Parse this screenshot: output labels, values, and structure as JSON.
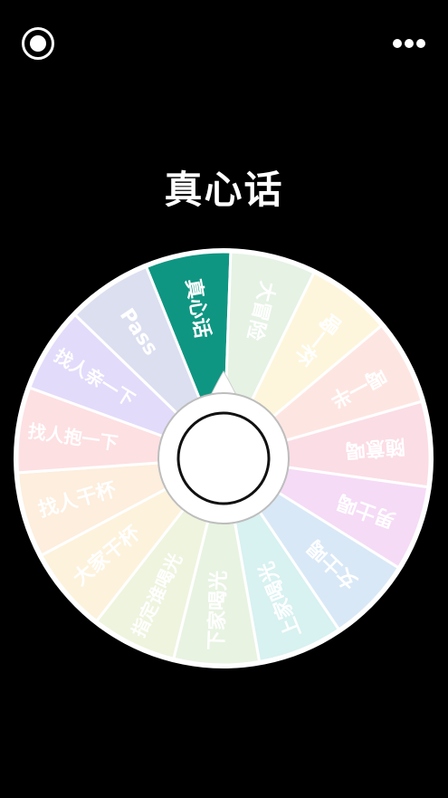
{
  "app": {
    "current_result": "真心话",
    "record_icon": "record-icon",
    "more_icon": "more-dots-icon"
  },
  "wheel": {
    "segments": [
      {
        "label": "真心话",
        "color": "#0f9682",
        "text_color": "#ffffff"
      },
      {
        "label": "大冒险",
        "color": "#e5f2e4",
        "text_color": "#ffffff"
      },
      {
        "label": "喝一杯",
        "color": "#fdf6dc",
        "text_color": "#ffffff"
      },
      {
        "label": "喝一半",
        "color": "#fde6e2",
        "text_color": "#ffffff"
      },
      {
        "label": "随意喝",
        "color": "#fbdde5",
        "text_color": "#ffffff"
      },
      {
        "label": "男士喝",
        "color": "#f5dbf6",
        "text_color": "#ffffff"
      },
      {
        "label": "女士喝",
        "color": "#d9e8f6",
        "text_color": "#ffffff"
      },
      {
        "label": "上家喝光",
        "color": "#d8f1f1",
        "text_color": "#ffffff"
      },
      {
        "label": "下家喝光",
        "color": "#e8f3e2",
        "text_color": "#ffffff"
      },
      {
        "label": "指定谁喝光",
        "color": "#eef4de",
        "text_color": "#ffffff"
      },
      {
        "label": "大家干杯",
        "color": "#fdf2dc",
        "text_color": "#ffffff"
      },
      {
        "label": "找人干杯",
        "color": "#fdeedd",
        "text_color": "#ffffff"
      },
      {
        "label": "找人抱一下",
        "color": "#fde0e2",
        "text_color": "#ffffff"
      },
      {
        "label": "找人亲一下",
        "color": "#e3dbfa",
        "text_color": "#ffffff"
      },
      {
        "label": "Pass",
        "color": "#dcdff0",
        "text_color": "#ffffff"
      }
    ]
  }
}
